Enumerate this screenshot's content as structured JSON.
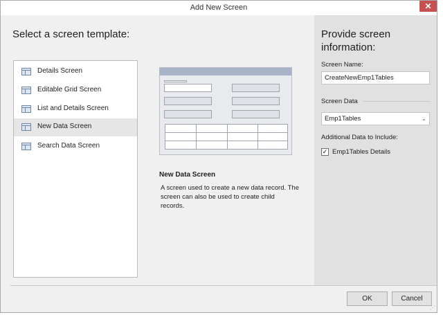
{
  "window": {
    "title": "Add New Screen",
    "close_label": "✕"
  },
  "left": {
    "heading": "Select a screen template:",
    "templates": [
      {
        "label": "Details Screen"
      },
      {
        "label": "Editable Grid Screen"
      },
      {
        "label": "List and Details Screen"
      },
      {
        "label": "New Data Screen",
        "selected": true
      },
      {
        "label": "Search Data Screen"
      }
    ],
    "description_title": "New Data Screen",
    "description_text": "A screen used to create a new data record. The screen can also be used to create child records."
  },
  "right": {
    "heading": "Provide screen information:",
    "screen_name_label": "Screen Name:",
    "screen_name_value": "CreateNewEmp1Tables",
    "screen_data_label": "Screen Data",
    "screen_data_value": "Emp1Tables",
    "additional_label": "Additional Data to Include:",
    "additional_item_label": "Emp1Tables Details",
    "additional_item_checked": true
  },
  "footer": {
    "ok_label": "OK",
    "cancel_label": "Cancel"
  },
  "colors": {
    "close": "#c75050",
    "selected_row": "#e6e6e6",
    "right_panel": "#e1e1e1"
  }
}
